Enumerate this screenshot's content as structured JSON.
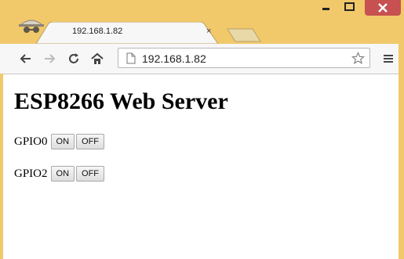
{
  "browser": {
    "tab_title": "192.168.1.82",
    "close_tab": "×",
    "url": "192.168.1.82",
    "frame_color": "#f1c86a"
  },
  "page": {
    "heading": "ESP8266 Web Server",
    "gpios": [
      {
        "label": "GPIO0",
        "on_label": "ON",
        "off_label": "OFF"
      },
      {
        "label": "GPIO2",
        "on_label": "ON",
        "off_label": "OFF"
      }
    ]
  }
}
